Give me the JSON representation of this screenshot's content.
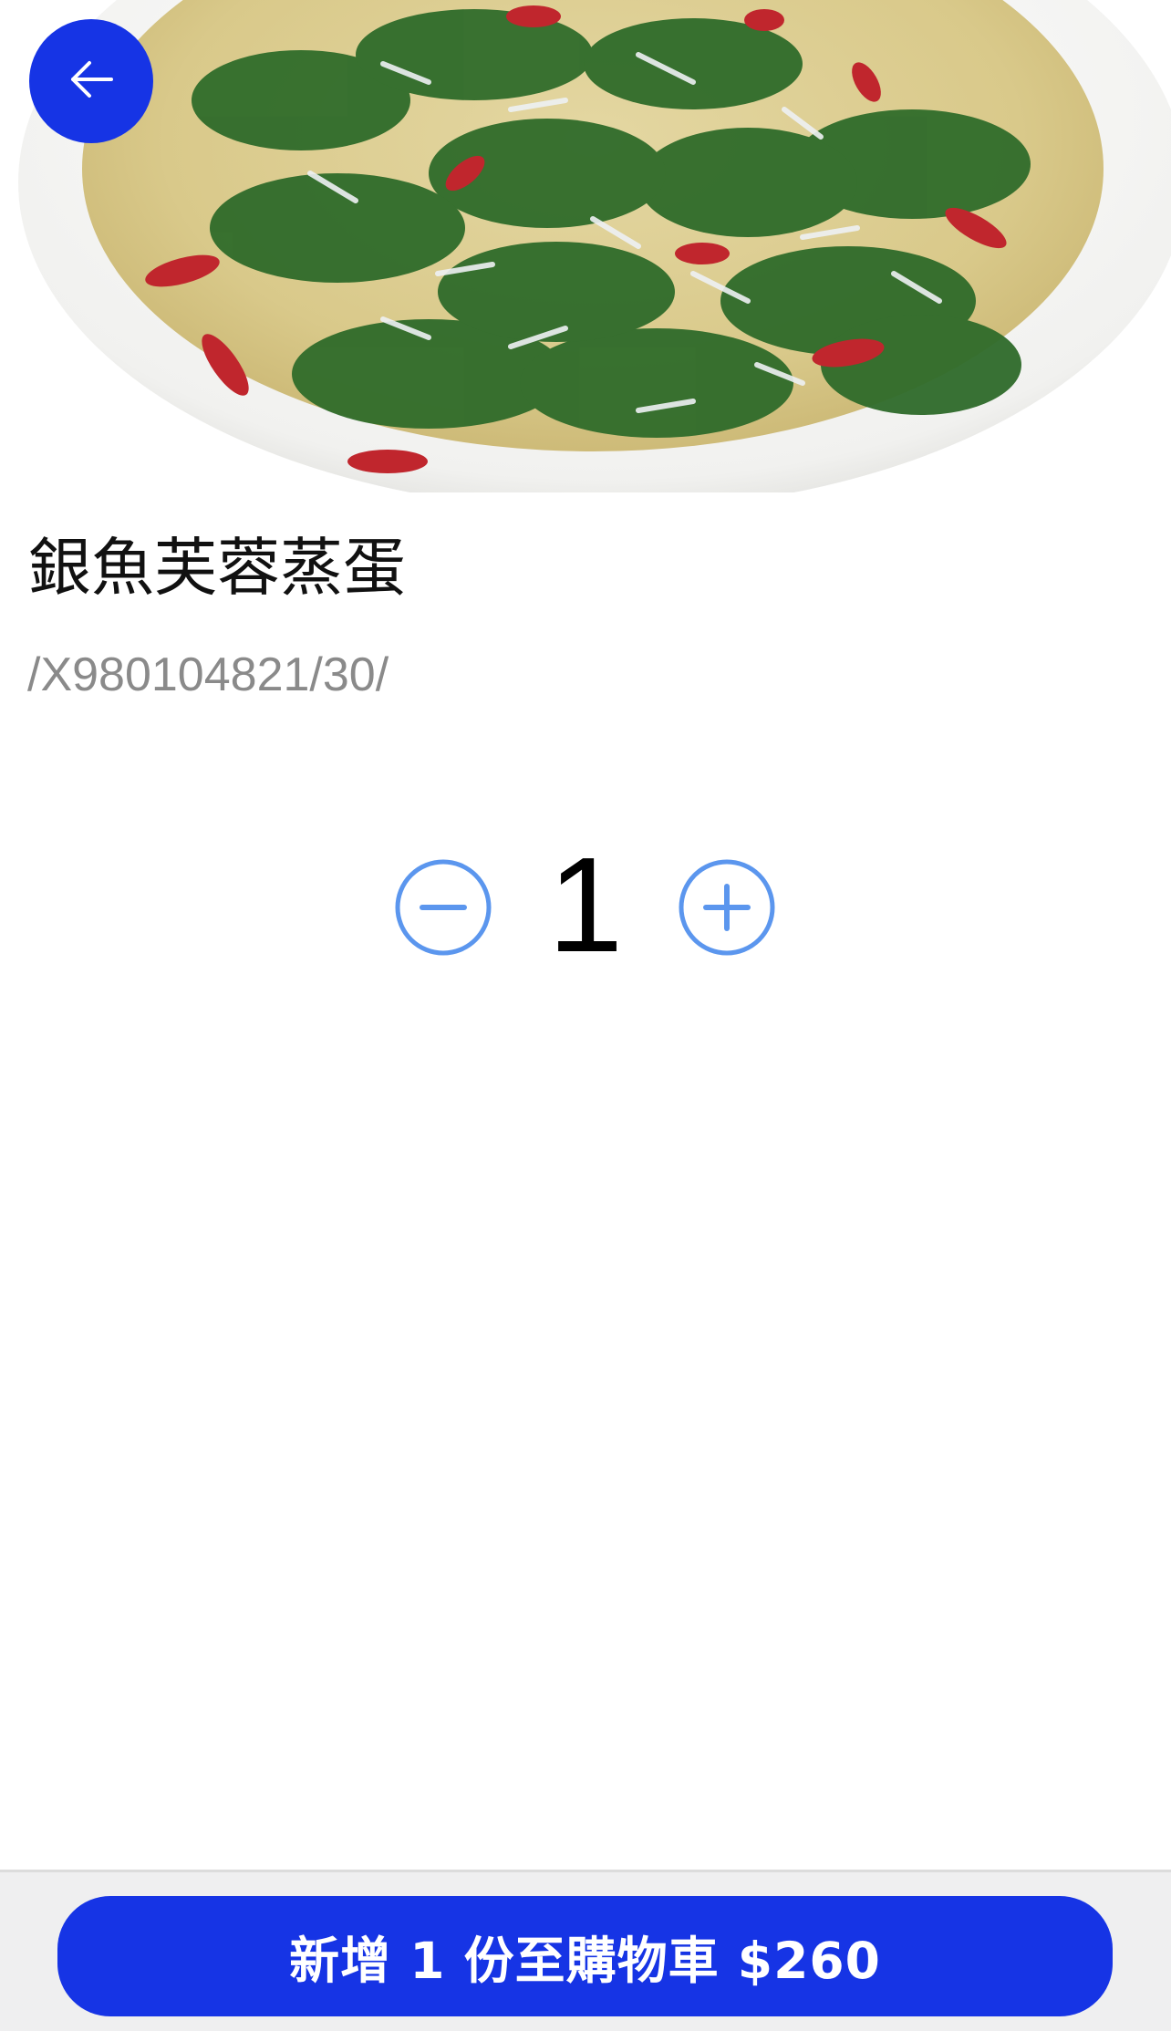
{
  "theme": {
    "primary": "#1634e5",
    "stepper_accent": "#5b96ee",
    "text_secondary": "#8a8a8a"
  },
  "header": {
    "back_icon": "arrow-left-icon"
  },
  "product": {
    "name": "銀魚芙蓉蒸蛋",
    "code": "/X980104821/30/"
  },
  "stepper": {
    "quantity": "1",
    "minus_icon": "minus-circle-icon",
    "plus_icon": "plus-circle-icon"
  },
  "cart": {
    "button_label": "新增 1 份至購物車 $260"
  }
}
